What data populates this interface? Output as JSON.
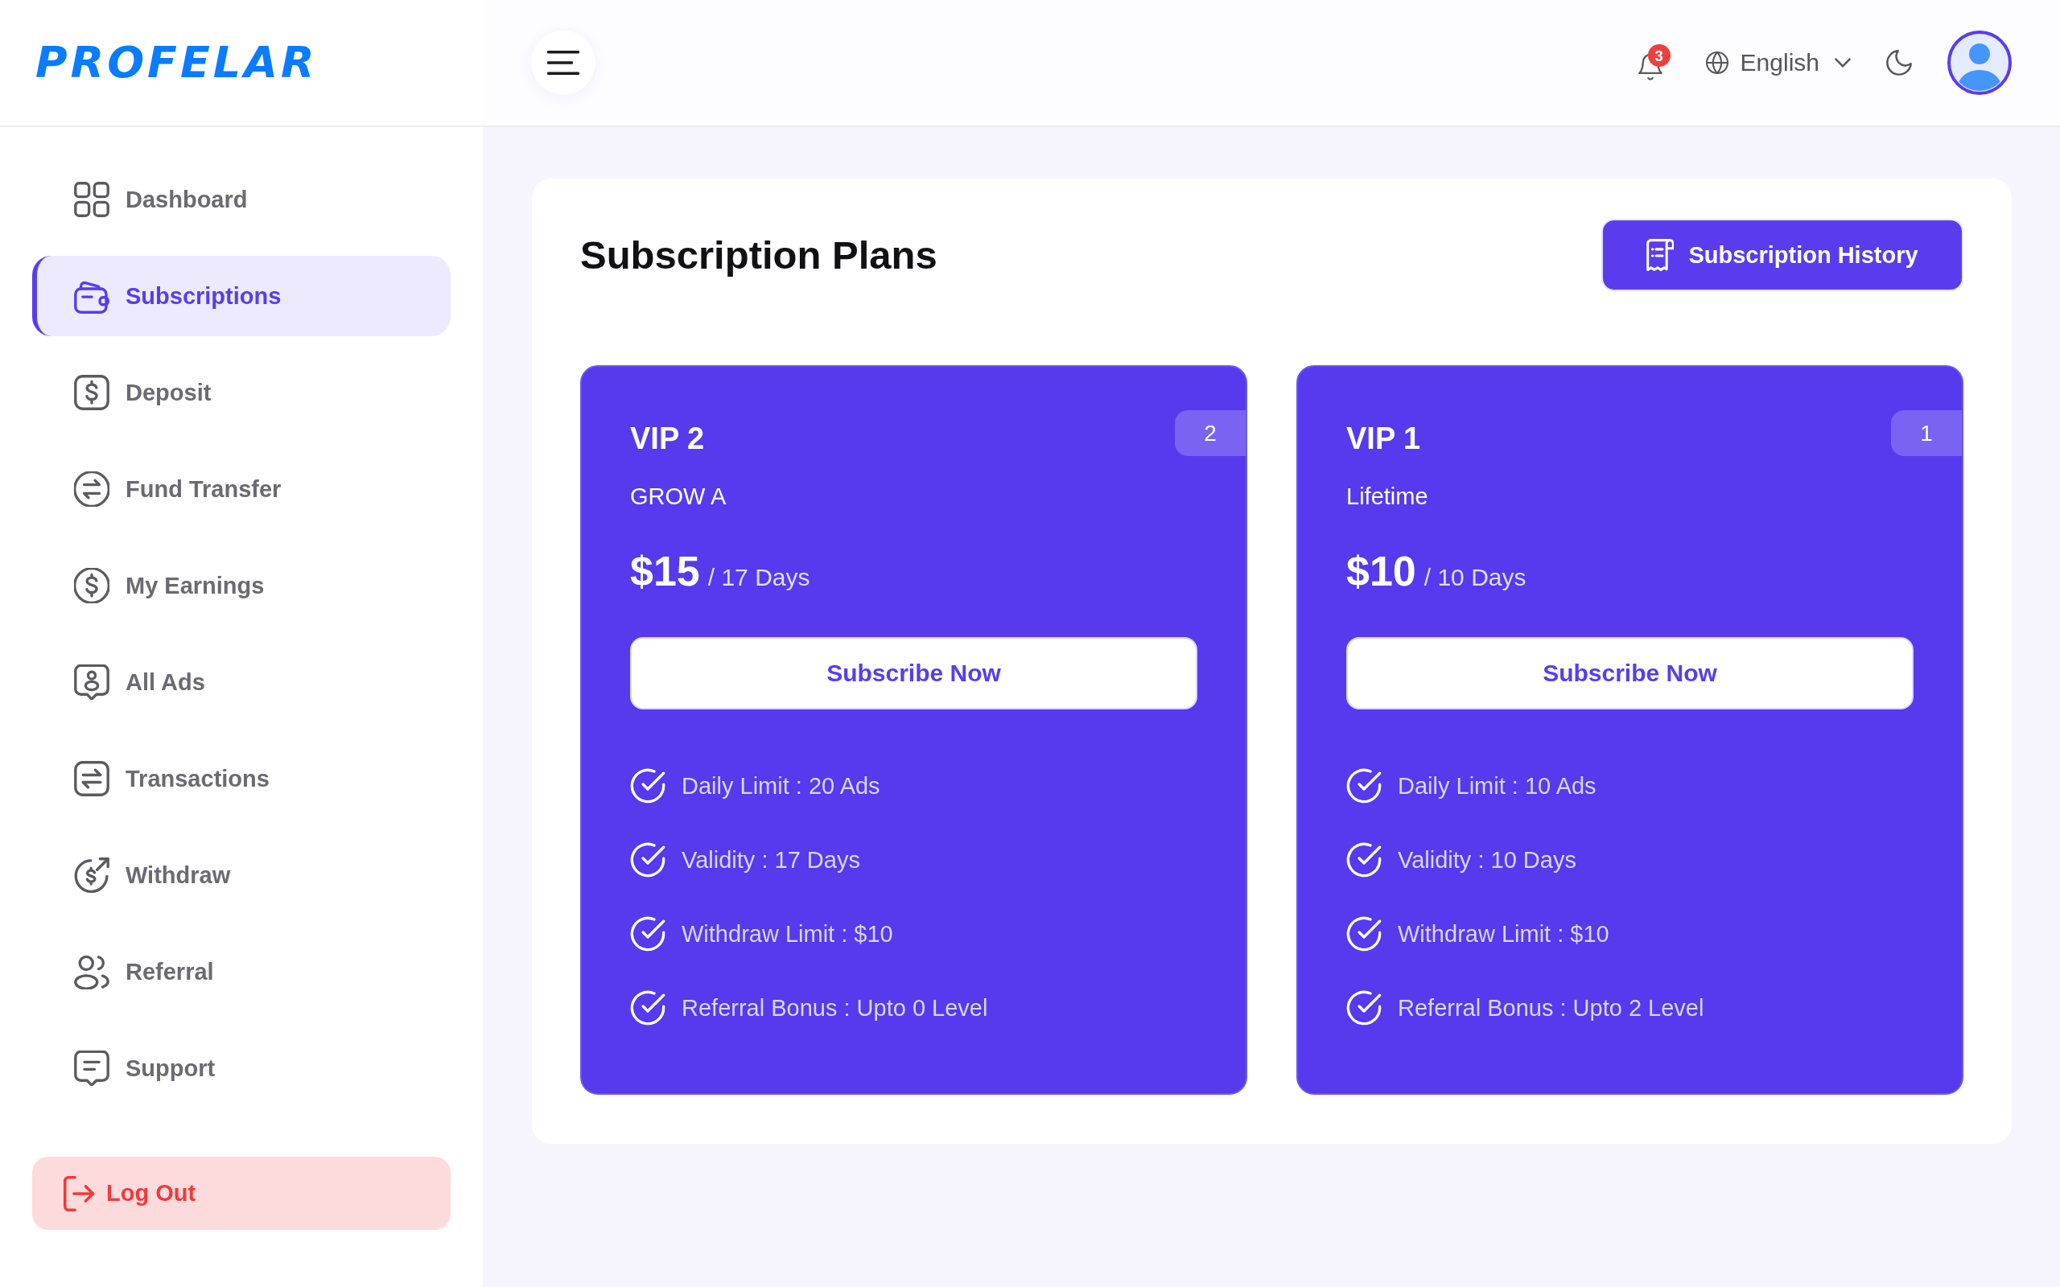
{
  "brand": {
    "logo": "PROFELAR"
  },
  "header": {
    "notification_count": "3",
    "language": "English"
  },
  "sidebar": {
    "items": [
      {
        "label": "Dashboard",
        "selected": false
      },
      {
        "label": "Subscriptions",
        "selected": true
      },
      {
        "label": "Deposit",
        "selected": false
      },
      {
        "label": "Fund Transfer",
        "selected": false
      },
      {
        "label": "My Earnings",
        "selected": false
      },
      {
        "label": "All Ads",
        "selected": false
      },
      {
        "label": "Transactions",
        "selected": false
      },
      {
        "label": "Withdraw",
        "selected": false
      },
      {
        "label": "Referral",
        "selected": false
      },
      {
        "label": "Support",
        "selected": false
      }
    ],
    "logout": "Log Out"
  },
  "page": {
    "title": "Subscription Plans",
    "history_button": "Subscription History"
  },
  "plans": [
    {
      "name": "VIP 2",
      "badge": "2",
      "subtitle": "GROW A",
      "price": "$15",
      "period": "/ 17 Days",
      "button": "Subscribe Now",
      "features": [
        "Daily Limit : 20 Ads",
        "Validity : 17 Days",
        "Withdraw Limit : $10",
        "Referral Bonus : Upto 0 Level"
      ]
    },
    {
      "name": "VIP 1",
      "badge": "1",
      "subtitle": "Lifetime",
      "price": "$10",
      "period": "/ 10 Days",
      "button": "Subscribe Now",
      "features": [
        "Daily Limit : 10 Ads",
        "Validity : 10 Days",
        "Withdraw Limit : $10",
        "Referral Bonus : Upto 2 Level"
      ]
    }
  ]
}
